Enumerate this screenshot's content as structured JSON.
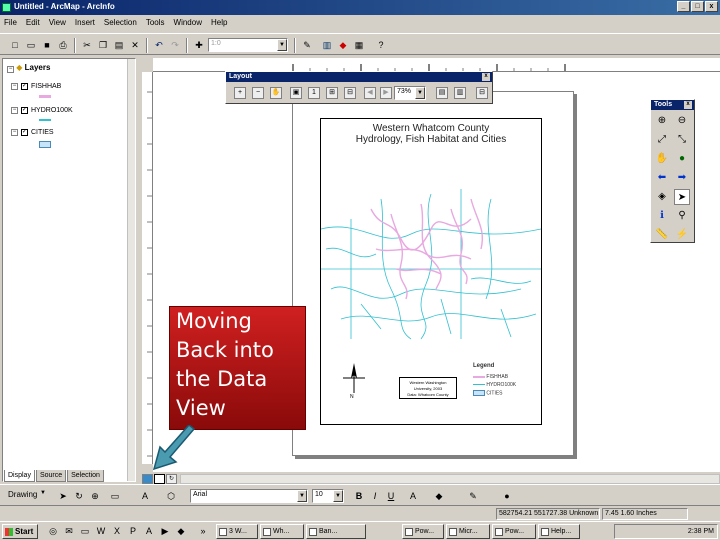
{
  "window": {
    "title": "Untitled - ArcMap - ArcInfo",
    "minimize": "_",
    "maximize": "□",
    "close": "x"
  },
  "menu": [
    "File",
    "Edit",
    "View",
    "Insert",
    "Selection",
    "Tools",
    "Window",
    "Help"
  ],
  "toolbar": {
    "icons": [
      "new-icon",
      "open-icon",
      "save-icon",
      "print-icon",
      "cut-icon",
      "copy-icon",
      "paste-icon",
      "delete-icon",
      "undo-icon",
      "redo-icon",
      "add-data-icon"
    ],
    "scale_value": "1:0",
    "right_icons": [
      "editor-icon",
      "arctoolbox-icon",
      "arccatalog-icon",
      "help-icon"
    ]
  },
  "toc": {
    "header": "Layers",
    "layers": [
      {
        "name": "FISHHAB",
        "checked": true
      },
      {
        "name": "HYDRO100K",
        "checked": true
      },
      {
        "name": "CITIES",
        "checked": true
      }
    ],
    "tabs": [
      "Display",
      "Source",
      "Selection"
    ],
    "active_tab": "Display"
  },
  "layout_toolbar": {
    "title": "Layout",
    "close": "x",
    "zoom_value": "73%"
  },
  "tools_toolbar": {
    "title": "Tools",
    "close": "x"
  },
  "map": {
    "title_line1": "Western Whatcom County",
    "title_line2": "Hydrology, Fish Habitat and Cities",
    "legend_title": "Legend",
    "legend_items": [
      "FISHHAB",
      "HYDRO100K",
      "CITIES"
    ],
    "north_label": "N",
    "credit_lines": [
      "Western Washington",
      "University, 2003",
      "Data: Whatcom County"
    ]
  },
  "callout": {
    "lines": [
      "Moving",
      "Back into",
      "the Data",
      "View"
    ]
  },
  "drawing_toolbar": {
    "drawing_label": "Drawing",
    "font_value": "Arial",
    "size_value": "10",
    "bold": "B",
    "italic": "I",
    "underline": "U"
  },
  "status": {
    "coords": "582754.21  551727.38 Unknown",
    "page_units": "7.45  1.60 Inches"
  },
  "taskbar": {
    "start": "Start",
    "buttons": [
      "3 W...",
      "Wh...",
      "Ban...",
      "Pow...",
      "Micr...",
      "Pow...",
      "Help..."
    ],
    "clock": "2:38 PM"
  }
}
